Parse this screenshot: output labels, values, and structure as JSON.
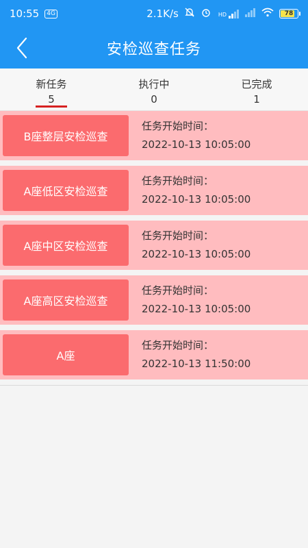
{
  "status_bar": {
    "time": "10:55",
    "left_badge": "4G",
    "net_speed": "2.1K/s",
    "hd_label": "HD",
    "battery_level": "78"
  },
  "navbar": {
    "title": "安检巡查任务",
    "back_icon": "chevron-left-icon"
  },
  "tabs": [
    {
      "label": "新任务",
      "count": "5",
      "active": true
    },
    {
      "label": "执行中",
      "count": "0",
      "active": false
    },
    {
      "label": "已完成",
      "count": "1",
      "active": false
    }
  ],
  "tasks": [
    {
      "name": "B座整层安检巡查",
      "start_label": "任务开始时间：",
      "start_time": "2022-10-13 10:05:00"
    },
    {
      "name": "A座低区安检巡查",
      "start_label": "任务开始时间：",
      "start_time": "2022-10-13 10:05:00"
    },
    {
      "name": "A座中区安检巡查",
      "start_label": "任务开始时间：",
      "start_time": "2022-10-13 10:05:00"
    },
    {
      "name": "A座高区安检巡查",
      "start_label": "任务开始时间：",
      "start_time": "2022-10-13 10:05:00"
    },
    {
      "name": "A座",
      "start_label": "任务开始时间：",
      "start_time": "2022-10-13 11:50:00"
    }
  ],
  "colors": {
    "header": "#2196f3",
    "card_bg": "#ffbcbf",
    "card_button": "#fb6b6e",
    "tab_underline": "#d62020"
  }
}
